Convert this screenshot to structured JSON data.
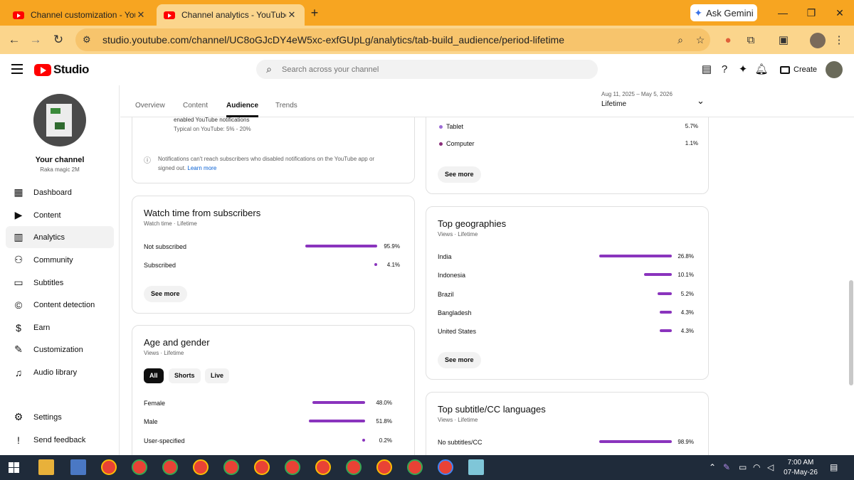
{
  "browser": {
    "tabs": [
      {
        "title": "Channel customization - YouTube Studio",
        "active": false
      },
      {
        "title": "Channel analytics - YouTube Studio",
        "active": true
      }
    ],
    "gemini_label": "Ask Gemini",
    "url": "studio.youtube.com/channel/UC8oGJcDY4eW5xc-exfGUpLg/analytics/tab-build_audience/period-lifetime"
  },
  "studio": {
    "logo_text": "Studio",
    "search_placeholder": "Search across your channel",
    "create_label": "Create"
  },
  "sidebar": {
    "channel_title": "Your channel",
    "channel_name": "Raka magic 2M",
    "items": [
      {
        "label": "Dashboard",
        "icon": "dashboard-icon"
      },
      {
        "label": "Content",
        "icon": "content-icon"
      },
      {
        "label": "Analytics",
        "icon": "analytics-icon",
        "active": true
      },
      {
        "label": "Community",
        "icon": "community-icon"
      },
      {
        "label": "Subtitles",
        "icon": "subtitles-icon"
      },
      {
        "label": "Content detection",
        "icon": "copyright-icon"
      },
      {
        "label": "Earn",
        "icon": "dollar-icon"
      },
      {
        "label": "Customization",
        "icon": "magic-wand-icon"
      },
      {
        "label": "Audio library",
        "icon": "audio-library-icon"
      }
    ],
    "bottom_items": [
      {
        "label": "Settings",
        "icon": "gear-icon"
      },
      {
        "label": "Send feedback",
        "icon": "feedback-icon"
      }
    ]
  },
  "analytics": {
    "tabs": [
      "Overview",
      "Content",
      "Audience",
      "Trends"
    ],
    "active_tab": "Audience",
    "period_range": "Aug 11, 2025 – May 5, 2026",
    "period_label": "Lifetime"
  },
  "notifications_card": {
    "line1": "enabled YouTube notifications",
    "line2": "Typical on YouTube: 5% - 20%",
    "note": "Notifications can't reach subscribers who disabled notifications on the YouTube app or",
    "note2": "signed out.",
    "learn_more": "Learn more"
  },
  "watch_time_card": {
    "title": "Watch time from subscribers",
    "subtitle": "Watch time · Lifetime",
    "rows": [
      {
        "label": "Not subscribed",
        "value": "95.9%",
        "pct": 95.9
      },
      {
        "label": "Subscribed",
        "value": "4.1%",
        "pct": 4.1
      }
    ],
    "see_more": "See more"
  },
  "age_gender_card": {
    "title": "Age and gender",
    "subtitle": "Views · Lifetime",
    "chips": [
      "All",
      "Shorts",
      "Live"
    ],
    "rows": [
      {
        "label": "Female",
        "value": "48.0%",
        "pct": 48.0
      },
      {
        "label": "Male",
        "value": "51.8%",
        "pct": 51.8
      },
      {
        "label": "User-specified",
        "value": "0.2%",
        "pct": 0.2
      }
    ]
  },
  "device_card": {
    "rows": [
      {
        "label": "Tablet",
        "value": "5.7%",
        "color": "#9c6bd6"
      },
      {
        "label": "Computer",
        "value": "1.1%",
        "color": "#8a2e7a"
      }
    ],
    "see_more": "See more"
  },
  "geographies_card": {
    "title": "Top geographies",
    "subtitle": "Views · Lifetime",
    "rows": [
      {
        "label": "India",
        "value": "26.8%",
        "pct": 26.8
      },
      {
        "label": "Indonesia",
        "value": "10.1%",
        "pct": 10.1
      },
      {
        "label": "Brazil",
        "value": "5.2%",
        "pct": 5.2
      },
      {
        "label": "Bangladesh",
        "value": "4.3%",
        "pct": 4.3
      },
      {
        "label": "United States",
        "value": "4.3%",
        "pct": 4.3
      }
    ],
    "see_more": "See more"
  },
  "subtitles_card": {
    "title": "Top subtitle/CC languages",
    "subtitle": "Views · Lifetime",
    "rows": [
      {
        "label": "No subtitles/CC",
        "value": "98.9%",
        "pct": 98.9
      }
    ]
  },
  "taskbar": {
    "time": "7:00 AM",
    "date": "07-May-26"
  },
  "colors": {
    "accent_bar": "#8a34bd",
    "browser_frame": "#f7a521"
  }
}
